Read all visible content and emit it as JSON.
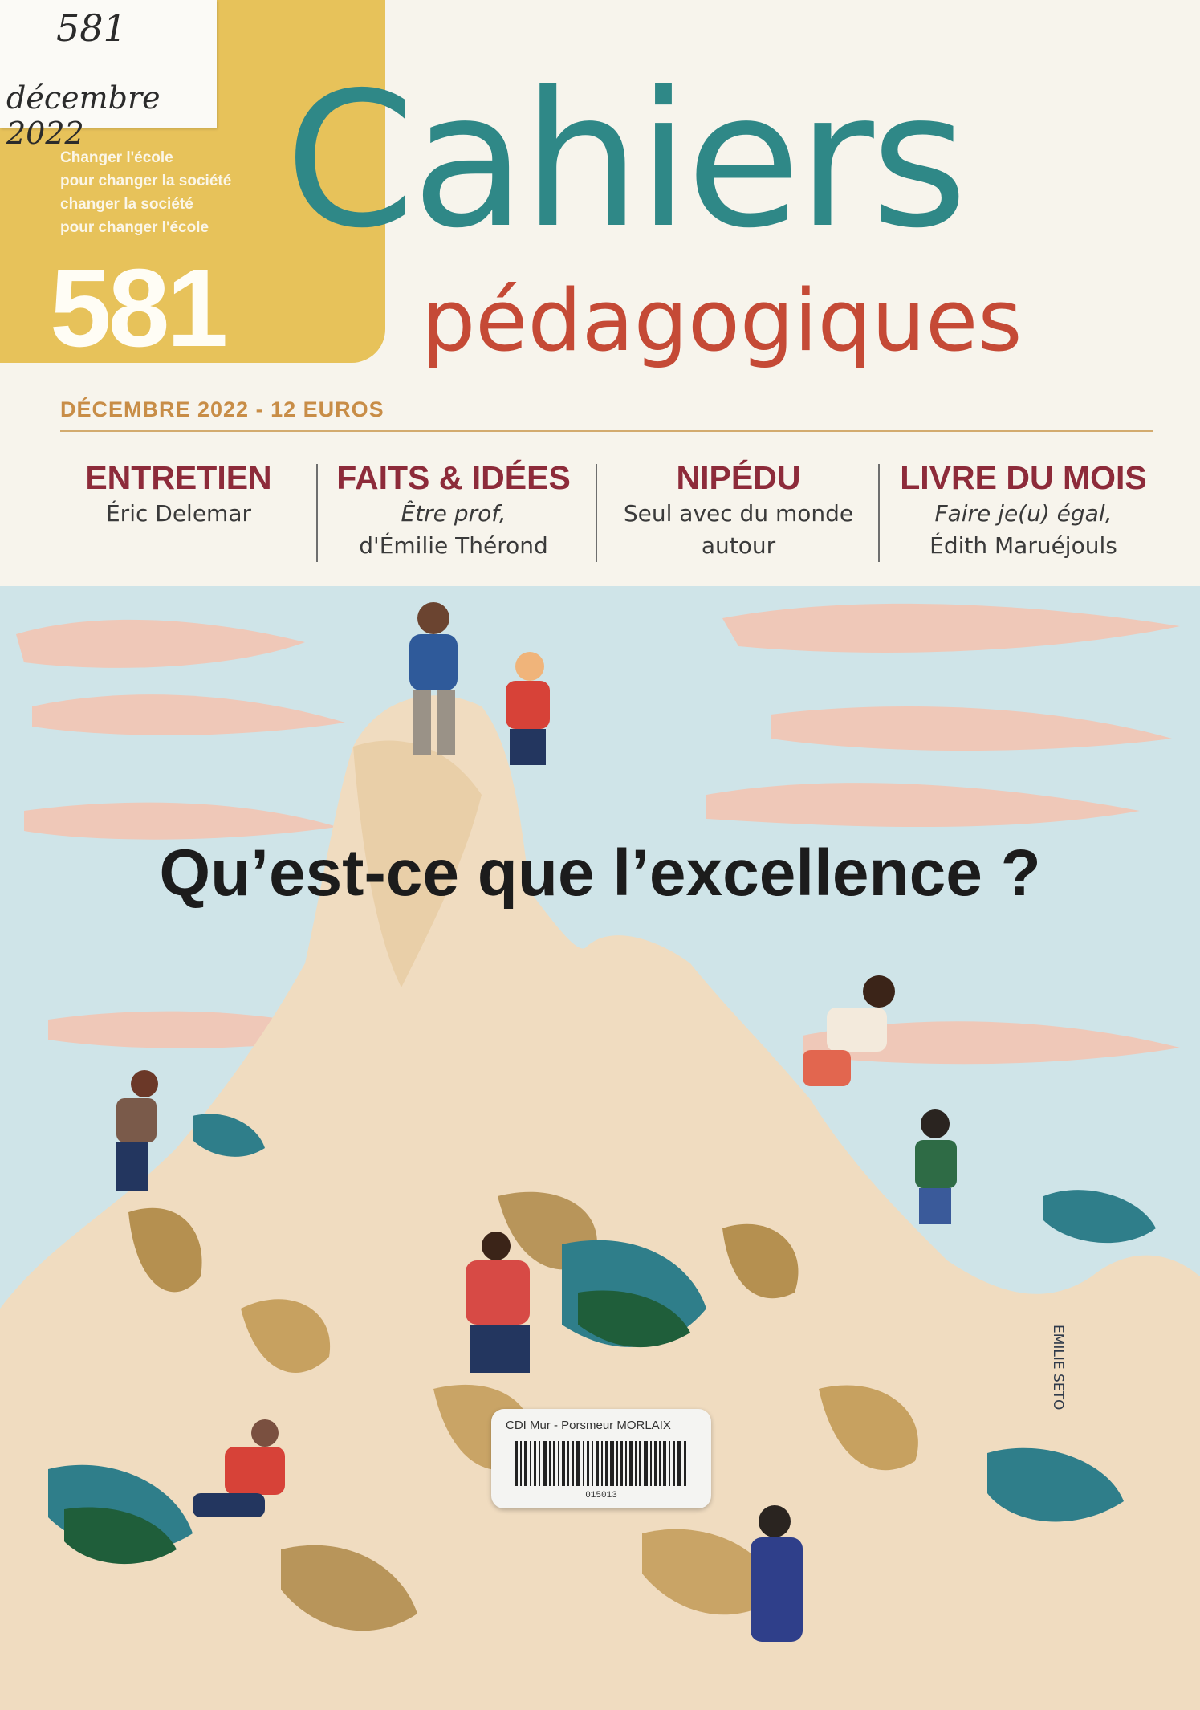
{
  "handwritten": {
    "number": "581",
    "date": "décembre 2022"
  },
  "tagline": [
    "Changer l'école",
    "pour changer la société",
    "changer la société",
    "pour changer l'école"
  ],
  "issue_number": "581",
  "title": {
    "main": "Cahiers",
    "sub": "pédagogiques"
  },
  "dateline": "DÉCEMBRE 2022 - 12 EUROS",
  "rubrics": [
    {
      "head": "ENTRETIEN",
      "lines": [
        "Éric Delemar"
      ]
    },
    {
      "head": "FAITS & IDÉES",
      "lines": [
        "Être prof,",
        "d'Émilie Thérond"
      ]
    },
    {
      "head": "NIPÉDU",
      "lines": [
        "Seul avec du monde",
        "autour"
      ]
    },
    {
      "head": "LIVRE DU MOIS",
      "lines": [
        "Faire je(u) égal,",
        "Édith Maruéjouls"
      ]
    }
  ],
  "headline": "Qu’est-ce que l’excellence ?",
  "illustrator_signature": "EMILIE SETO",
  "library_sticker": {
    "text": "CDI Mur - Porsmeur MORLAIX",
    "code": "015013"
  },
  "colors": {
    "title_teal": "#2f8887",
    "title_red": "#c54a36",
    "band_yellow": "#e7c25a",
    "rubric_red": "#8d2b3a",
    "sky": "#cfe4e8"
  }
}
